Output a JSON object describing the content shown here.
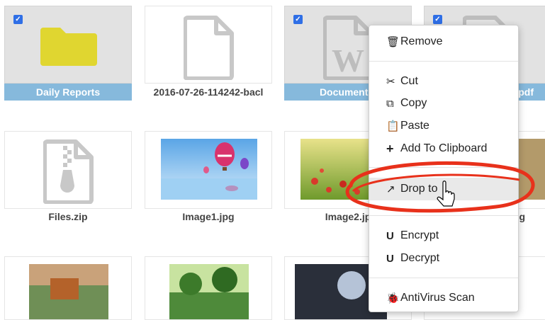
{
  "files": [
    {
      "name": "Daily Reports",
      "selected": true,
      "icon": "folder-icon"
    },
    {
      "name": "2016-07-26-114242-bacl",
      "selected": false,
      "icon": "file-icon"
    },
    {
      "name": "Document1.",
      "selected": true,
      "icon": "word-document-icon"
    },
    {
      "name": "pdf",
      "selected": true,
      "icon": "pdf-icon"
    },
    {
      "name": "Files.zip",
      "selected": false,
      "icon": "zip-file-icon"
    },
    {
      "name": "Image1.jpg",
      "selected": false,
      "icon": "image-thumbnail"
    },
    {
      "name": "Image2.jp",
      "selected": false,
      "icon": "image-thumbnail"
    },
    {
      "name": "g",
      "selected": false,
      "icon": "image-thumbnail"
    }
  ],
  "context_menu": {
    "items": [
      {
        "key": "remove",
        "label": "Remove",
        "icon": "trash-icon"
      },
      {
        "key": "cut",
        "label": "Cut",
        "icon": "scissors-icon"
      },
      {
        "key": "copy",
        "label": "Copy",
        "icon": "copy-icon"
      },
      {
        "key": "paste",
        "label": "Paste",
        "icon": "paste-icon"
      },
      {
        "key": "add-to-clipboard",
        "label": "Add To Clipboard",
        "icon": "plus-icon"
      },
      {
        "key": "drop-to",
        "label": "Drop to",
        "icon": "share-icon",
        "highlighted": true
      },
      {
        "key": "encrypt",
        "label": "Encrypt",
        "icon": "magnet-icon"
      },
      {
        "key": "decrypt",
        "label": "Decrypt",
        "icon": "magnet-icon"
      },
      {
        "key": "antivirus-scan",
        "label": "AntiVirus Scan",
        "icon": "bug-icon"
      }
    ]
  },
  "colors": {
    "selection_bar": "#86b9dc",
    "checkbox": "#2f6fe6",
    "folder": "#e0d630",
    "annotation": "#e8311b"
  }
}
